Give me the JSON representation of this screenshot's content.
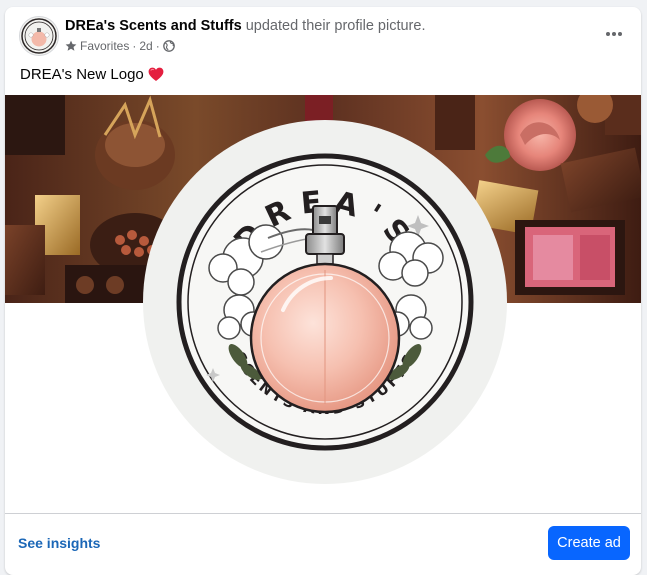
{
  "post": {
    "page_name": "DREa's Scents and Stuffs",
    "action_text": "updated their profile picture.",
    "audience_label": "Favorites",
    "separator": "·",
    "time_ago": "2d",
    "caption": "DREA's New Logo",
    "caption_emoji": "red-heart",
    "more_icon": "more-horizontal-icon"
  },
  "logo": {
    "top_text": "DREA'S",
    "bottom_text": "SCENTS AND STUFFS",
    "colors": {
      "ring": "#231f20",
      "bottle": "#f4b9a8",
      "background": "#f0f0ee"
    }
  },
  "footer": {
    "insights_label": "See insights",
    "create_ad_label": "Create ad"
  },
  "colors": {
    "accent": "#0866ff",
    "link": "#1b67b7",
    "heart": "#e41e3f"
  }
}
